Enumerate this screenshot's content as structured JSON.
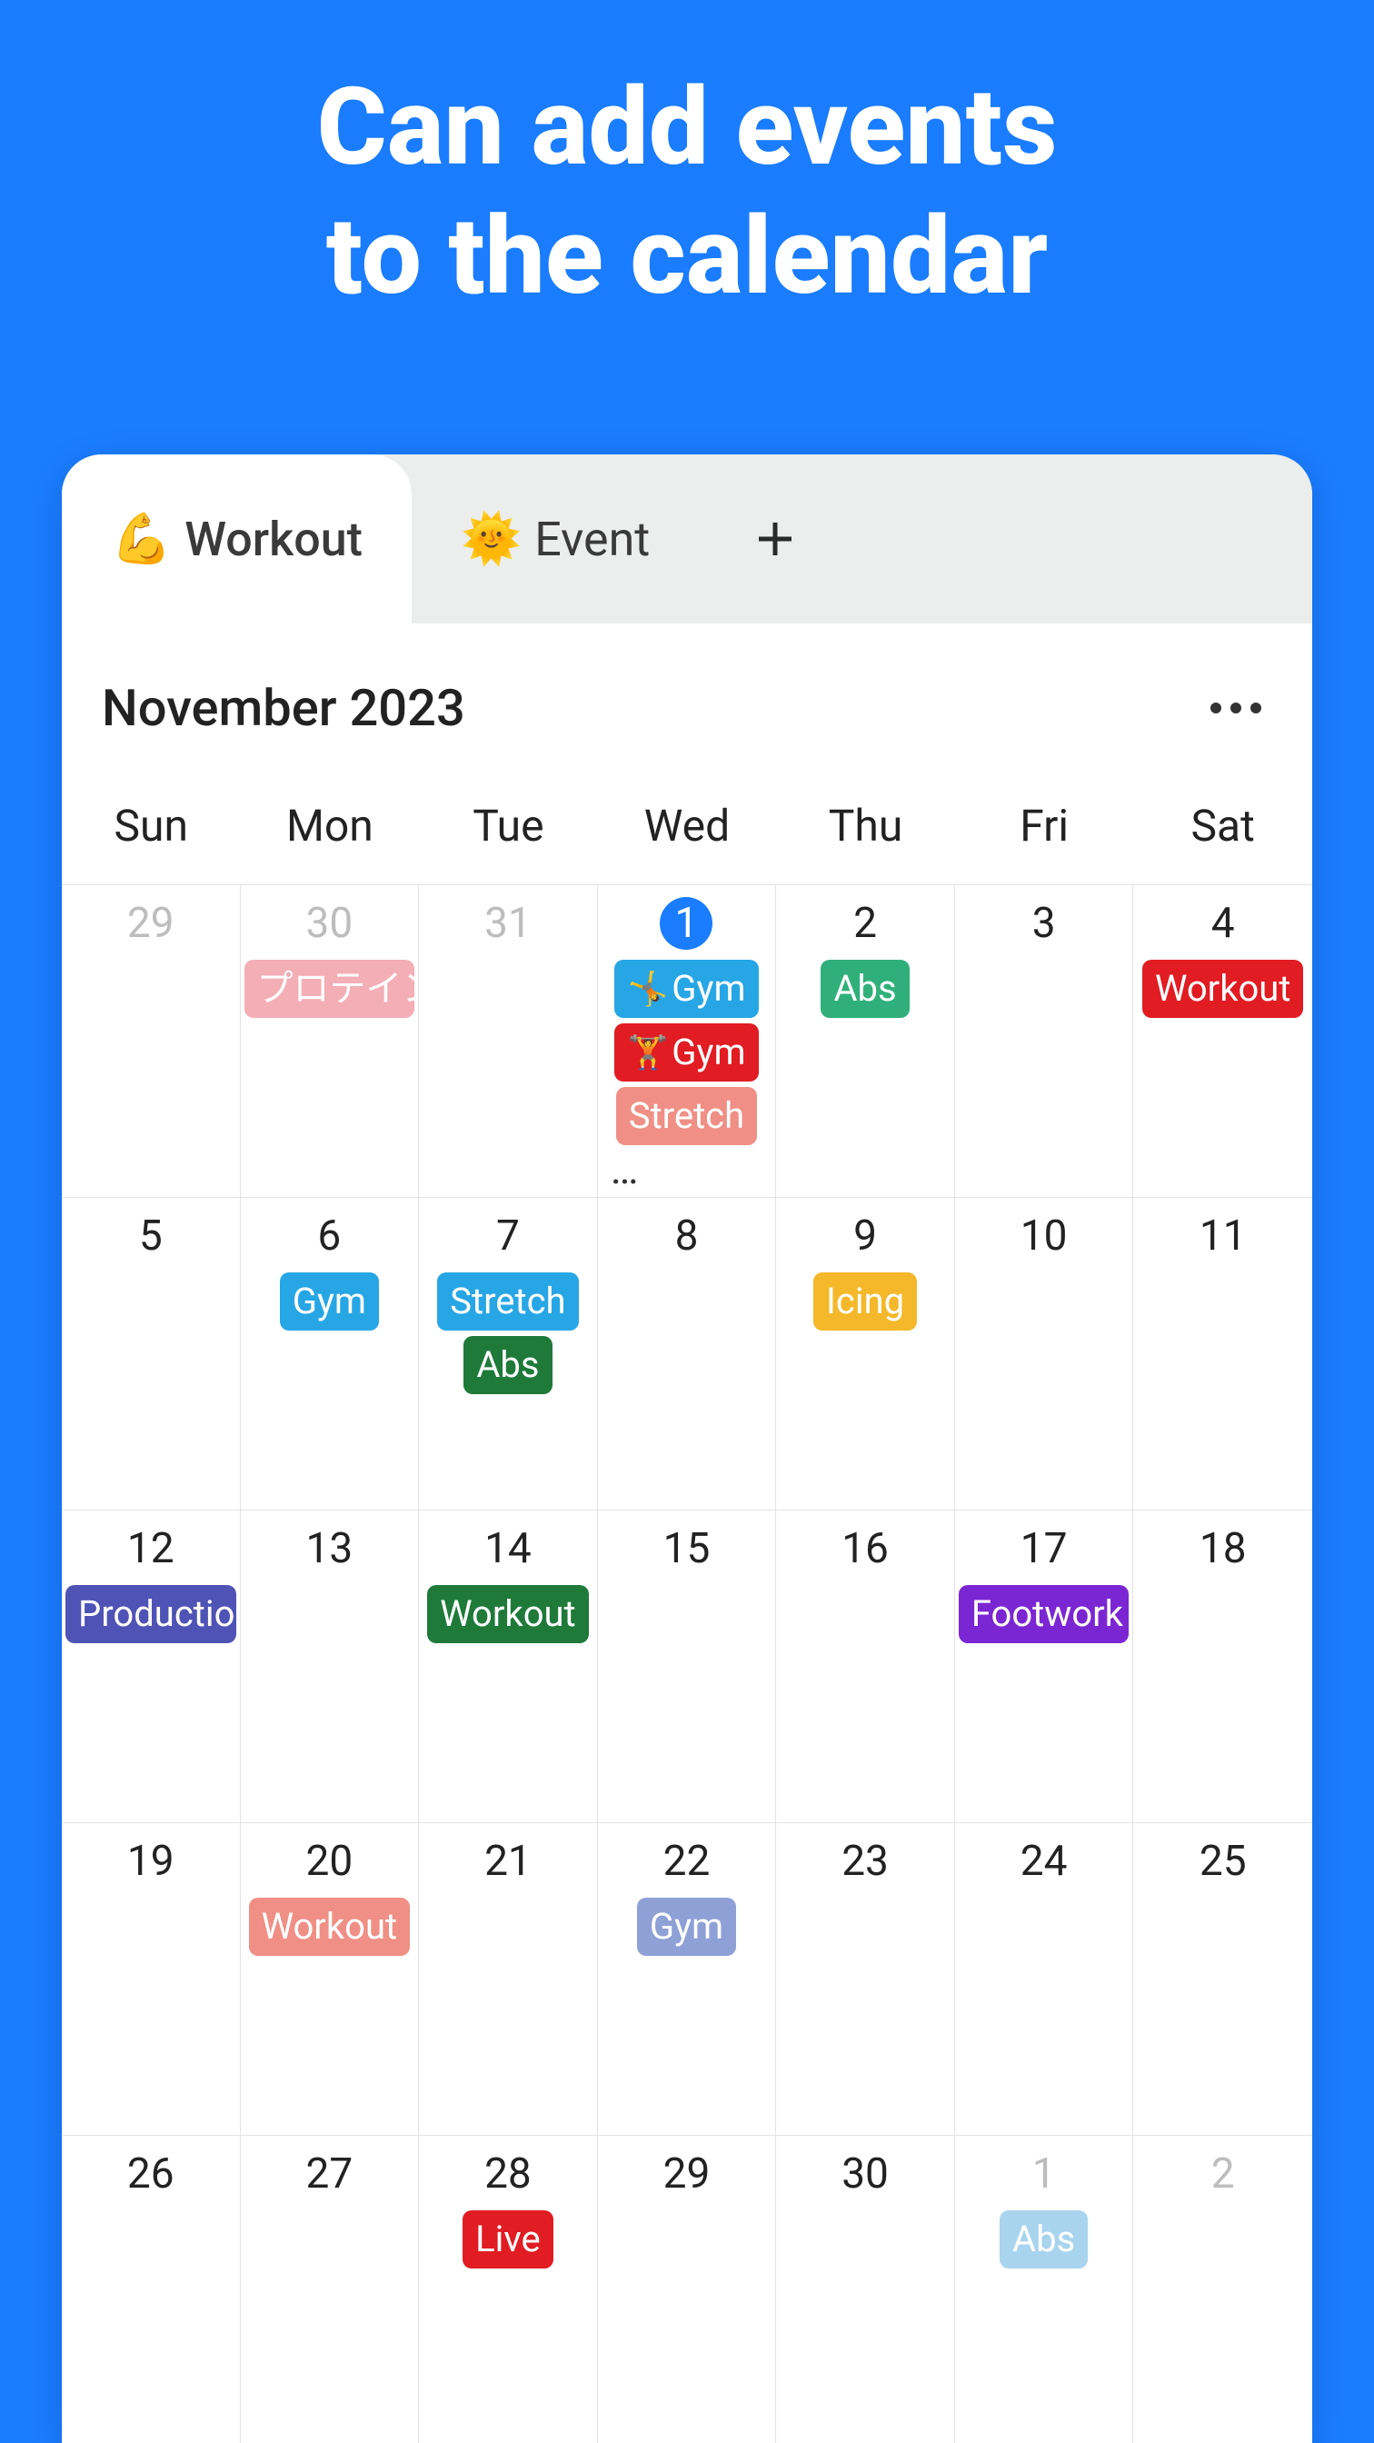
{
  "hero": {
    "line1": "Can add events",
    "line2": "to the calendar"
  },
  "tabs": {
    "workout": {
      "emoji": "💪",
      "label": "Workout"
    },
    "event": {
      "emoji": "🌞",
      "label": "Event"
    }
  },
  "month": {
    "title": "November 2023"
  },
  "weekdays": [
    "Sun",
    "Mon",
    "Tue",
    "Wed",
    "Thu",
    "Fri",
    "Sat"
  ],
  "colors": {
    "blue": "#27a6e6",
    "red": "#e11c23",
    "teal": "#2fb07a",
    "salmon": "#f08f85",
    "pink": "#f4aeb6",
    "forest": "#1f7a3a",
    "amber": "#f4b82a",
    "indigo": "#4f53b5",
    "violet": "#7b26d3",
    "periwinkle": "#8ea0d6",
    "skylight": "#a9d4ee"
  },
  "weeks": [
    [
      {
        "n": "29",
        "other": true
      },
      {
        "n": "30",
        "other": true,
        "events": [
          {
            "label": "プロテイン",
            "colorKey": "pink"
          }
        ]
      },
      {
        "n": "31",
        "other": true
      },
      {
        "n": "1",
        "today": true,
        "more": true,
        "events": [
          {
            "emoji": "🤸",
            "label": "Gym",
            "colorKey": "blue"
          },
          {
            "emoji": "🏋️",
            "label": "Gym",
            "colorKey": "red"
          },
          {
            "label": "Stretch",
            "colorKey": "salmon"
          }
        ]
      },
      {
        "n": "2",
        "events": [
          {
            "label": "Abs",
            "colorKey": "teal"
          }
        ]
      },
      {
        "n": "3"
      },
      {
        "n": "4",
        "events": [
          {
            "label": "Workout",
            "colorKey": "red"
          }
        ]
      }
    ],
    [
      {
        "n": "5"
      },
      {
        "n": "6",
        "events": [
          {
            "label": "Gym",
            "colorKey": "blue"
          }
        ]
      },
      {
        "n": "7",
        "events": [
          {
            "label": "Stretch",
            "colorKey": "blue"
          },
          {
            "label": "Abs",
            "colorKey": "forest"
          }
        ]
      },
      {
        "n": "8"
      },
      {
        "n": "9",
        "events": [
          {
            "label": "Icing",
            "colorKey": "amber"
          }
        ]
      },
      {
        "n": "10"
      },
      {
        "n": "11"
      }
    ],
    [
      {
        "n": "12",
        "events": [
          {
            "label": "Productio",
            "colorKey": "indigo"
          }
        ]
      },
      {
        "n": "13"
      },
      {
        "n": "14",
        "events": [
          {
            "label": "Workout",
            "colorKey": "forest"
          }
        ]
      },
      {
        "n": "15"
      },
      {
        "n": "16"
      },
      {
        "n": "17",
        "events": [
          {
            "label": "Footwork",
            "colorKey": "violet"
          }
        ]
      },
      {
        "n": "18"
      }
    ],
    [
      {
        "n": "19"
      },
      {
        "n": "20",
        "events": [
          {
            "label": "Workout",
            "colorKey": "salmon"
          }
        ]
      },
      {
        "n": "21"
      },
      {
        "n": "22",
        "events": [
          {
            "label": "Gym",
            "colorKey": "periwinkle"
          }
        ]
      },
      {
        "n": "23"
      },
      {
        "n": "24"
      },
      {
        "n": "25"
      }
    ],
    [
      {
        "n": "26"
      },
      {
        "n": "27"
      },
      {
        "n": "28",
        "events": [
          {
            "label": "Live",
            "colorKey": "red"
          }
        ]
      },
      {
        "n": "29"
      },
      {
        "n": "30"
      },
      {
        "n": "1",
        "other": true,
        "events": [
          {
            "label": "Abs",
            "colorKey": "skylight"
          }
        ]
      },
      {
        "n": "2",
        "other": true
      }
    ]
  ]
}
